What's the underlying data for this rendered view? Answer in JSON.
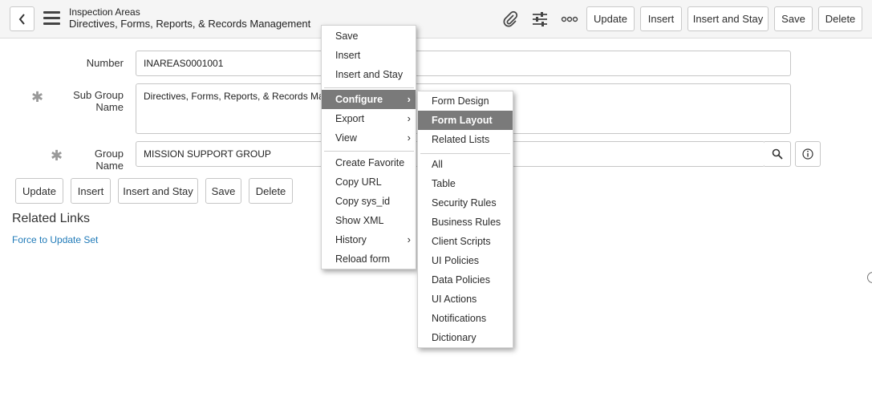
{
  "header": {
    "title": "Inspection Areas",
    "subtitle": "Directives, Forms, Reports, & Records Management",
    "buttons": {
      "update": "Update",
      "insert": "Insert",
      "insert_and_stay": "Insert and Stay",
      "save": "Save",
      "delete": "Delete"
    }
  },
  "form": {
    "number_label": "Number",
    "number_value": "INAREAS0001001",
    "sub_group_label": "Sub Group Name",
    "sub_group_value": "Directives, Forms, Reports, & Records Management",
    "group_label": "Group Name",
    "group_value": "MISSION SUPPORT GROUP",
    "buttons": {
      "update": "Update",
      "insert": "Insert",
      "insert_and_stay": "Insert and Stay",
      "save": "Save",
      "delete": "Delete"
    }
  },
  "related": {
    "title": "Related Links",
    "link": "Force to Update Set"
  },
  "context_menu": {
    "save": "Save",
    "insert": "Insert",
    "insert_and_stay": "Insert and Stay",
    "configure": "Configure",
    "export": "Export",
    "view": "View",
    "create_favorite": "Create Favorite",
    "copy_url": "Copy URL",
    "copy_sys_id": "Copy sys_id",
    "show_xml": "Show XML",
    "history": "History",
    "reload_form": "Reload form"
  },
  "configure_menu": {
    "form_design": "Form Design",
    "form_layout": "Form Layout",
    "related_lists": "Related Lists",
    "all": "All",
    "table": "Table",
    "security_rules": "Security Rules",
    "business_rules": "Business Rules",
    "client_scripts": "Client Scripts",
    "ui_policies": "UI Policies",
    "data_policies": "Data Policies",
    "ui_actions": "UI Actions",
    "notifications": "Notifications",
    "dictionary": "Dictionary"
  },
  "glyphs": {
    "chevron": "›",
    "required": "✱"
  },
  "colors": {
    "highlight": "#7a7a7a",
    "link": "#1f7ab8"
  },
  "icons": [
    "back-icon",
    "hamburger-icon",
    "paperclip-icon",
    "sliders-icon",
    "more-icon",
    "search-icon",
    "info-icon",
    "chevron-right-icon"
  ]
}
